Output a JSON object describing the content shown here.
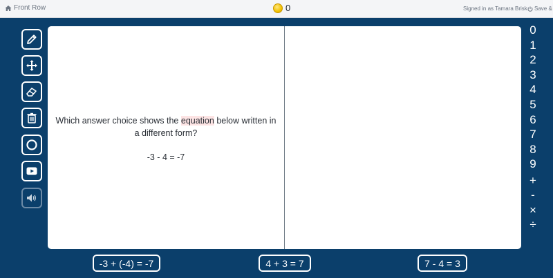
{
  "topbar": {
    "front_row_label": "Front Row",
    "coin_count": "0",
    "signed_in_text": "Signed in as Tamara Brisk",
    "save_quit_label": "Save & Q"
  },
  "tools": [
    {
      "name": "pencil-tool",
      "icon": "pencil-icon"
    },
    {
      "name": "move-tool",
      "icon": "move-icon"
    },
    {
      "name": "eraser-tool",
      "icon": "eraser-icon"
    },
    {
      "name": "trash-tool",
      "icon": "trash-icon"
    },
    {
      "name": "circle-tool",
      "icon": "circle-icon"
    },
    {
      "name": "video-tool",
      "icon": "play-icon"
    },
    {
      "name": "audio-tool",
      "icon": "speaker-icon"
    }
  ],
  "question": {
    "text_before": "Which answer choice shows the ",
    "highlighted_word": "equation",
    "text_after": " below written in a different form?",
    "equation": "-3 - 4 = -7"
  },
  "keypad": [
    "0",
    "1",
    "2",
    "3",
    "4",
    "5",
    "6",
    "7",
    "8",
    "9",
    "+",
    "-",
    "×",
    "÷"
  ],
  "answers": [
    "-3 + (-4) = -7",
    "4 + 3 = 7",
    "7 - 4 = 3"
  ],
  "colors": {
    "background": "#0b3f6b",
    "highlight": "#fde4e4",
    "coin": "#f2c200"
  }
}
